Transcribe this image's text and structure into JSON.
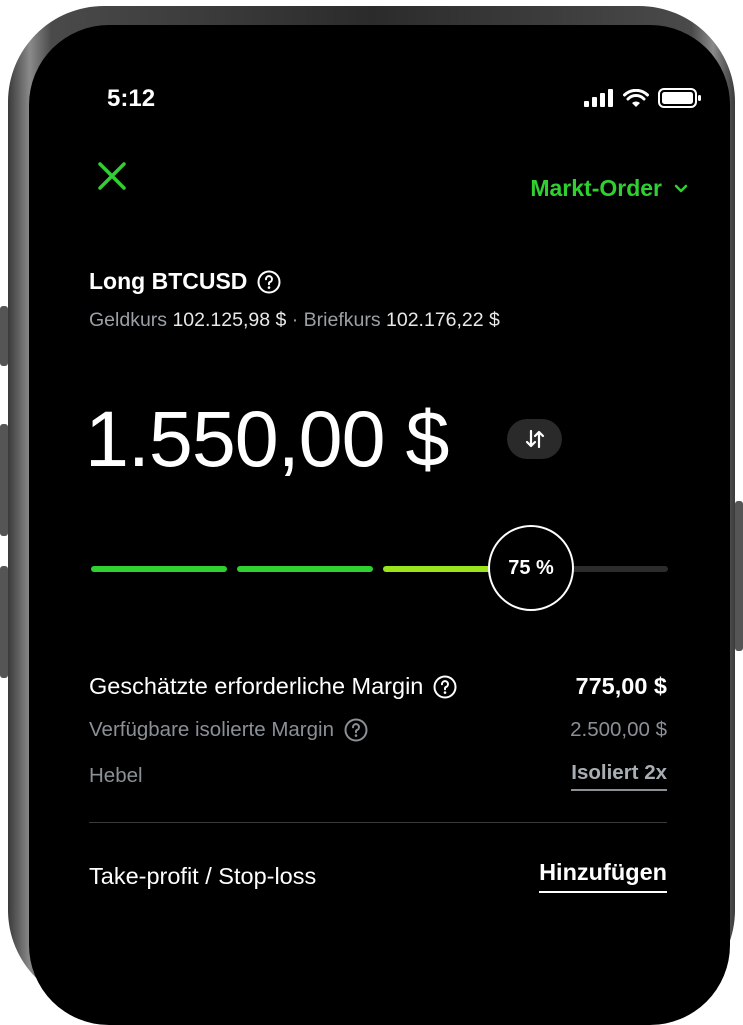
{
  "status_bar": {
    "time": "5:12"
  },
  "header": {
    "order_type": "Markt-Order"
  },
  "instrument": {
    "title": "Long BTCUSD"
  },
  "quotes": {
    "bid_label": "Geldkurs",
    "bid_value": "102.125,98 $",
    "separator": "·",
    "ask_label": "Briefkurs",
    "ask_value": "102.176,22 $"
  },
  "amount": {
    "value": "1.550,00 $"
  },
  "slider": {
    "percent_label": "75 %",
    "percent": 75
  },
  "margin": {
    "required_label": "Geschätzte erforderliche Margin",
    "required_value": "775,00 $",
    "available_label": "Verfügbare isolierte Margin",
    "available_value": "2.500,00 $",
    "leverage_label": "Hebel",
    "leverage_value": "Isoliert 2x"
  },
  "tpsl": {
    "label": "Take-profit / Stop-loss",
    "action": "Hinzufügen"
  },
  "colors": {
    "accent": "#2fd02f",
    "slider_light": "#9be31a",
    "background": "#000000"
  }
}
